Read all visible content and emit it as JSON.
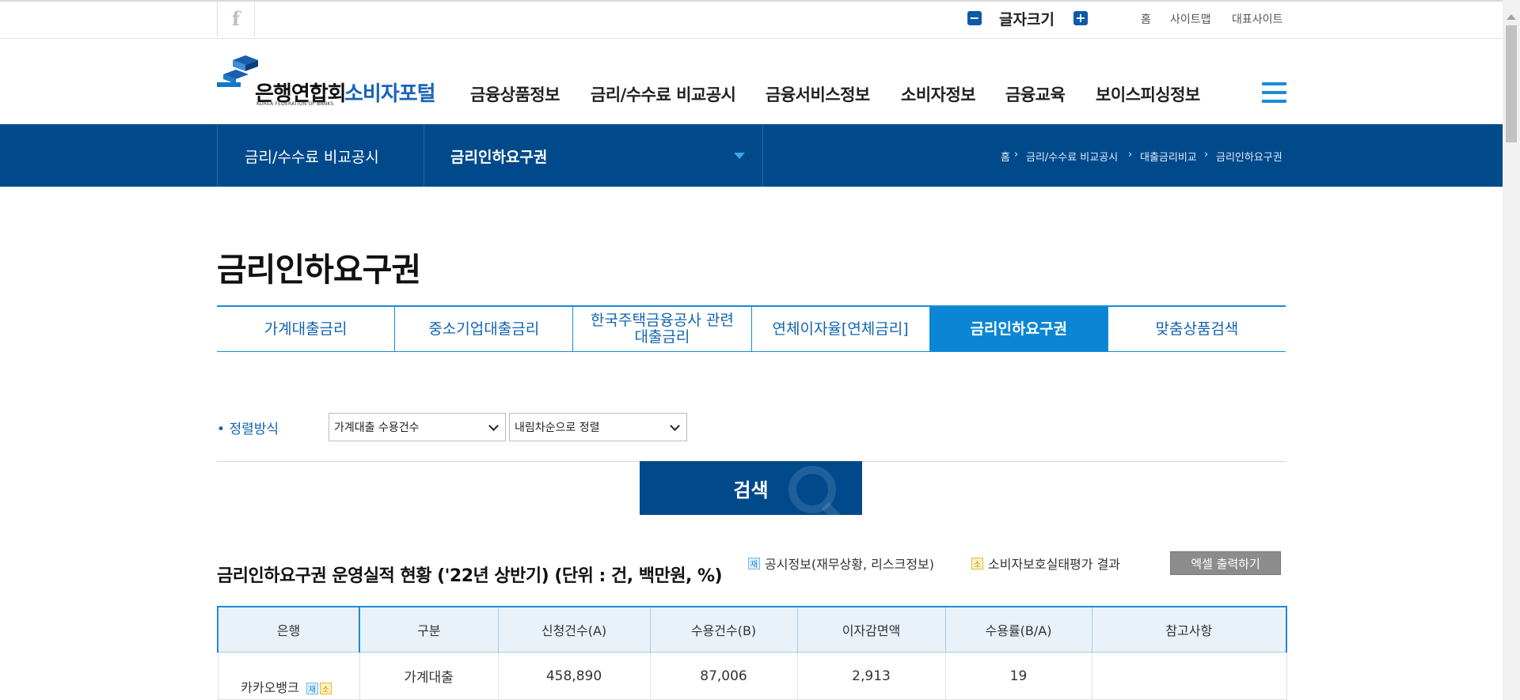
{
  "utility": {
    "facebook": "f",
    "font_size_label": "글자크기",
    "home": "홈",
    "sitemap": "사이트맵",
    "main_site": "대표사이트"
  },
  "header": {
    "logo_text": "은행연합회",
    "logo_subtext": "KOREA FEDERATION OF BANKS",
    "logo_portal": "소비자포털",
    "nav": [
      "금융상품정보",
      "금리/수수료 비교공시",
      "금융서비스정보",
      "소비자정보",
      "금융교육",
      "보이스피싱정보"
    ]
  },
  "subnav": {
    "section": "금리/수수료 비교공시",
    "current": "금리인하요구권",
    "breadcrumb": [
      "홈",
      "금리/수수료 비교공시",
      "대출금리비교",
      "금리인하요구권"
    ]
  },
  "page_title": "금리인하요구권",
  "tabs": [
    {
      "label": "가계대출금리",
      "active": false
    },
    {
      "label": "중소기업대출금리",
      "active": false
    },
    {
      "label": "한국주택금융공사 관련\n대출금리",
      "active": false
    },
    {
      "label": "연체이자율[연체금리]",
      "active": false
    },
    {
      "label": "금리인하요구권",
      "active": true
    },
    {
      "label": "맞춤상품검색",
      "active": false
    }
  ],
  "sort": {
    "label": "정렬방식",
    "field_value": "가계대출 수용건수",
    "order_value": "내림차순으로 정렬"
  },
  "search_button": "검색",
  "section": {
    "title": "금리인하요구권 운영실적 현황 ('22년 상반기) (단위 : 건, 백만원, %)",
    "legend_disclosure_badge": "재",
    "legend_disclosure": "공시정보(재무상황, 리스크정보)",
    "legend_consumer_badge": "소",
    "legend_consumer": "소비자보호실태평가 결과",
    "excel_button": "엑셀 출력하기"
  },
  "table": {
    "headers": [
      "은행",
      "구분",
      "신청건수(A)",
      "수용건수(B)",
      "이자감면액",
      "수용률(B/A)",
      "참고사항"
    ],
    "rows": [
      {
        "bank": "카카오뱅크",
        "type": "가계대출",
        "applications": "458,890",
        "accepted": "87,006",
        "reduction": "2,913",
        "rate": "19",
        "note": ""
      }
    ]
  },
  "colors": {
    "primary_dark": "#004a8c",
    "accent": "#1a8ad8",
    "active_tab": "#0a86d4"
  }
}
